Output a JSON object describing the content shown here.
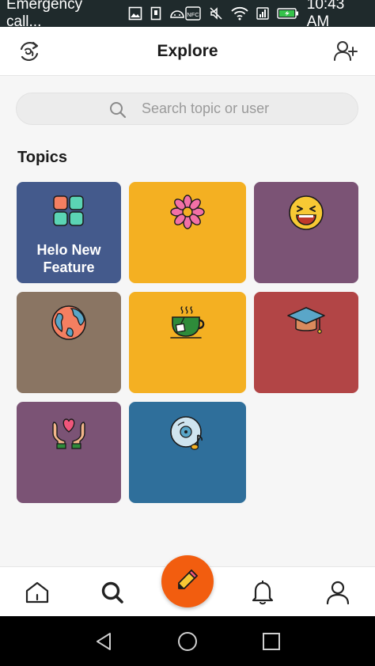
{
  "status_bar": {
    "notification_text": "Emergency call...",
    "time": "10:43 AM",
    "icons": [
      "image-icon",
      "sim-icon",
      "android-icon",
      "nfc-icon",
      "mute-icon",
      "wifi-icon",
      "signal-icon",
      "battery-icon"
    ],
    "nfc_label": "NFC"
  },
  "header": {
    "title": "Explore",
    "left_icon": "logo-icon",
    "right_icon": "add-user-icon"
  },
  "search": {
    "placeholder": "Search topic or user",
    "icon": "search-icon"
  },
  "topics": {
    "heading": "Topics",
    "tiles": [
      {
        "label": "Helo New Feature",
        "label_line1": "Helo New",
        "label_line2": "Feature",
        "icon": "apps-grid-icon",
        "color": "#445a8c"
      },
      {
        "label": "",
        "icon": "flower-icon",
        "color": "#f4b022"
      },
      {
        "label": "",
        "icon": "laughing-emoji-icon",
        "color": "#7b5375"
      },
      {
        "label": "",
        "icon": "globe-icon",
        "color": "#8a7563"
      },
      {
        "label": "",
        "icon": "tea-cup-icon",
        "color": "#f4b022"
      },
      {
        "label": "",
        "icon": "graduation-cap-icon",
        "color": "#b24546"
      },
      {
        "label": "",
        "icon": "heart-hands-icon",
        "color": "#7b5375"
      },
      {
        "label": "",
        "icon": "music-disc-icon",
        "color": "#2f6f9b"
      }
    ]
  },
  "bottom_nav": {
    "items": [
      "home-icon",
      "search-icon",
      "compose-icon",
      "bell-icon",
      "profile-icon"
    ],
    "fab_color": "#f25d0f"
  },
  "system_nav": {
    "items": [
      "back-icon",
      "home-circle-icon",
      "recents-icon"
    ]
  }
}
